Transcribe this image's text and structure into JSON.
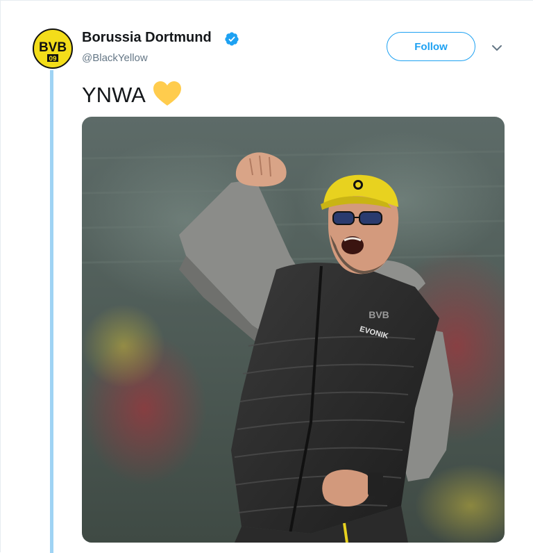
{
  "tweet": {
    "author": {
      "display_name": "Borussia Dortmund",
      "handle": "@BlackYellow",
      "verified": true,
      "avatar_text": "BVB",
      "avatar_year": "09",
      "avatar_icon": "bvb-logo"
    },
    "follow_label": "Follow",
    "menu_icon": "chevron-down-icon",
    "text": "YNWA",
    "emoji": "yellow-heart",
    "media": {
      "kind": "photo",
      "vest_logo": "BVB",
      "sponsor": "EVONIK"
    }
  },
  "colors": {
    "accent": "#1da1f2",
    "thread_line": "#9fd3f4",
    "bvb_yellow": "#f3dd1a",
    "heart": "#ffcc4d",
    "handle_gray": "#657786"
  }
}
